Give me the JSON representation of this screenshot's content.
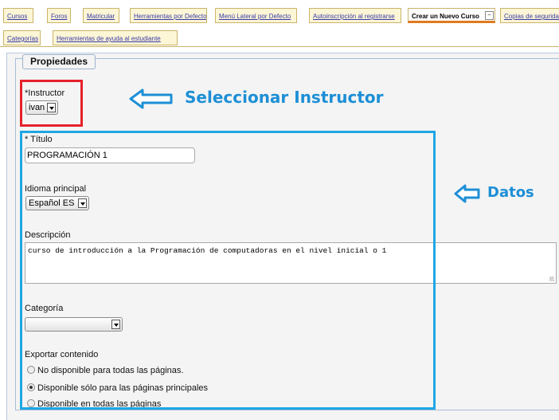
{
  "tabs_row1": [
    "Cursos",
    "Foros",
    "Matricular",
    "Herramientas por Defecto",
    "Menú Lateral por Defecto",
    "Autoinscripción al registrarse",
    "Crear un Nuevo Curso",
    "Copias de seguridad"
  ],
  "tabs_row2": [
    "Categorías",
    "Herramientas de ayuda al estudiante"
  ],
  "active_tab": "Crear un Nuevo Curso",
  "tab_collapse_symbol": "−",
  "section": {
    "legend": "Propiedades"
  },
  "instructor": {
    "label": "*Instructor",
    "value": "ivan"
  },
  "titulo": {
    "label": "* Título",
    "value": "PROGRAMACIÓN 1"
  },
  "idioma": {
    "label": "Idioma principal",
    "value": "Español ES"
  },
  "descripcion": {
    "label": "Descripción",
    "value": "curso de introducción a la Programación de computadoras en el nivel inicial o 1"
  },
  "categoria": {
    "label": "Categoría",
    "value": ""
  },
  "exportar": {
    "label": "Exportar contenido",
    "options": [
      {
        "label": "No disponible para todas las páginas.",
        "checked": false
      },
      {
        "label": "Disponible sólo para las páginas principales",
        "checked": true
      },
      {
        "label": "Disponible en todas las páginas",
        "checked": false
      }
    ]
  },
  "annotations": {
    "instructor_note": "Seleccionar Instructor",
    "datos_note": "Datos",
    "red_color": "#e5212b",
    "blue_color": "#1ea7e4",
    "arrow_icon": "left-arrow-icon"
  }
}
